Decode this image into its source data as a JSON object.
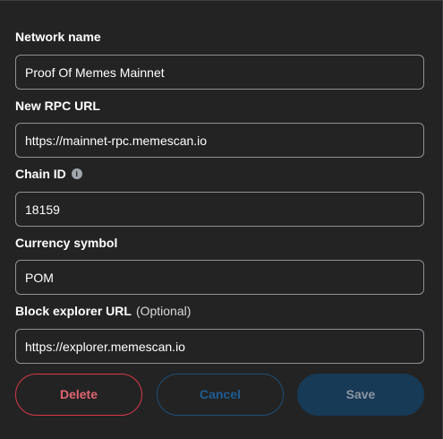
{
  "form": {
    "network_name": {
      "label": "Network name",
      "value": "Proof Of Memes Mainnet"
    },
    "rpc_url": {
      "label": "New RPC URL",
      "value": "https://mainnet-rpc.memescan.io"
    },
    "chain_id": {
      "label": "Chain ID",
      "info_icon": "info-icon",
      "value": "18159"
    },
    "currency_symbol": {
      "label": "Currency symbol",
      "value": "POM"
    },
    "block_explorer": {
      "label": "Block explorer URL",
      "optional": "(Optional)",
      "value": "https://explorer.memescan.io"
    }
  },
  "buttons": {
    "delete": "Delete",
    "cancel": "Cancel",
    "save": "Save"
  },
  "colors": {
    "background": "#232323",
    "delete": "#d73847",
    "primary": "#1d5d94",
    "save_disabled_bg": "#173a57"
  }
}
